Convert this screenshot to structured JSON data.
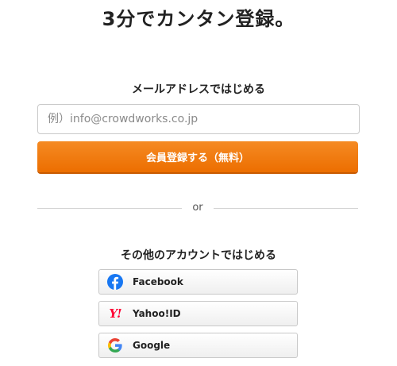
{
  "title": "3分でカンタン登録。",
  "email_section": {
    "heading": "メールアドレスではじめる",
    "placeholder": "例）info@crowdworks.co.jp",
    "submit_label": "会員登録する（無料）"
  },
  "divider_text": "or",
  "social_section": {
    "heading": "その他のアカウントではじめる",
    "buttons": [
      {
        "label": "Facebook",
        "icon": "facebook-icon"
      },
      {
        "label": "Yahoo!ID",
        "icon": "yahoo-icon",
        "icon_text": "Y!"
      },
      {
        "label": "Google",
        "icon": "google-icon"
      }
    ]
  },
  "colors": {
    "accent": "#f07b10",
    "facebook": "#1877f2",
    "yahoo": "#ff0033"
  }
}
